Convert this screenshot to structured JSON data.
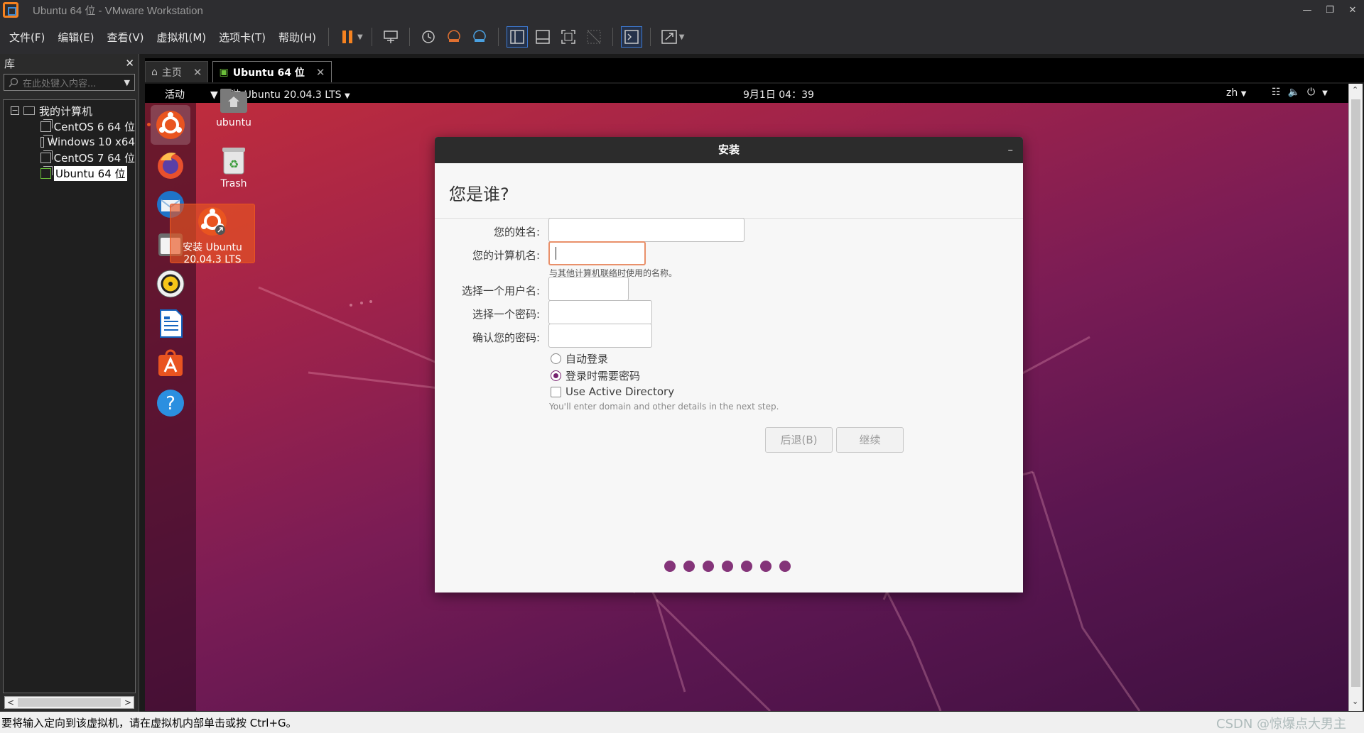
{
  "window": {
    "title": "Ubuntu 64 位 - VMware Workstation"
  },
  "menus": [
    "文件(F)",
    "编辑(E)",
    "查看(V)",
    "虚拟机(M)",
    "选项卡(T)",
    "帮助(H)"
  ],
  "library": {
    "title": "库",
    "search_placeholder": "在此处键入内容...",
    "root_label": "我的计算机",
    "vms": [
      "CentOS 6 64 位",
      "Windows 10 x64",
      "CentOS 7 64 位",
      "Ubuntu 64 位"
    ]
  },
  "tabs": [
    {
      "label": "主页"
    },
    {
      "label": "Ubuntu 64 位"
    }
  ],
  "gnome_top": {
    "activities": "活动",
    "app_menu": "安装 Ubuntu 20.04.3 LTS",
    "clock": "9月1日  04：39",
    "lang": "zh"
  },
  "desktop": {
    "home_label": "ubuntu",
    "trash_label": "Trash",
    "install_line1": "安装 Ubuntu",
    "install_line2": "20.04.3 LTS"
  },
  "installer": {
    "title": "安装",
    "question": "您是谁?",
    "name_label": "您的姓名:",
    "name_value": "",
    "computer_label": "您的计算机名:",
    "computer_value": "",
    "computer_hint": "与其他计算机联络时使用的名称。",
    "username_label": "选择一个用户名:",
    "username_value": "",
    "password_label": "选择一个密码:",
    "confirm_label": "确认您的密码:",
    "auto_login": "自动登录",
    "require_password": "登录时需要密码",
    "active_directory": "Use Active Directory",
    "ad_hint": "You'll enter domain and other details in the next step.",
    "back_button": "后退(B)",
    "continue_button": "继续",
    "progress_dots": 7
  },
  "statusbar": {
    "text": "要将输入定向到该虚拟机，请在虚拟机内部单击或按 Ctrl+G。",
    "watermark": "CSDN @惊爆点大男主"
  },
  "colors": {
    "ubuntu_orange": "#e95420",
    "aubergine": "#77216f",
    "progress_dot": "#843479"
  },
  "icons": {
    "dock": [
      "ubuntu-installer-icon",
      "firefox-icon",
      "thunderbird-icon",
      "files-icon",
      "rhythmbox-icon",
      "writer-icon",
      "software-icon",
      "help-icon"
    ]
  }
}
